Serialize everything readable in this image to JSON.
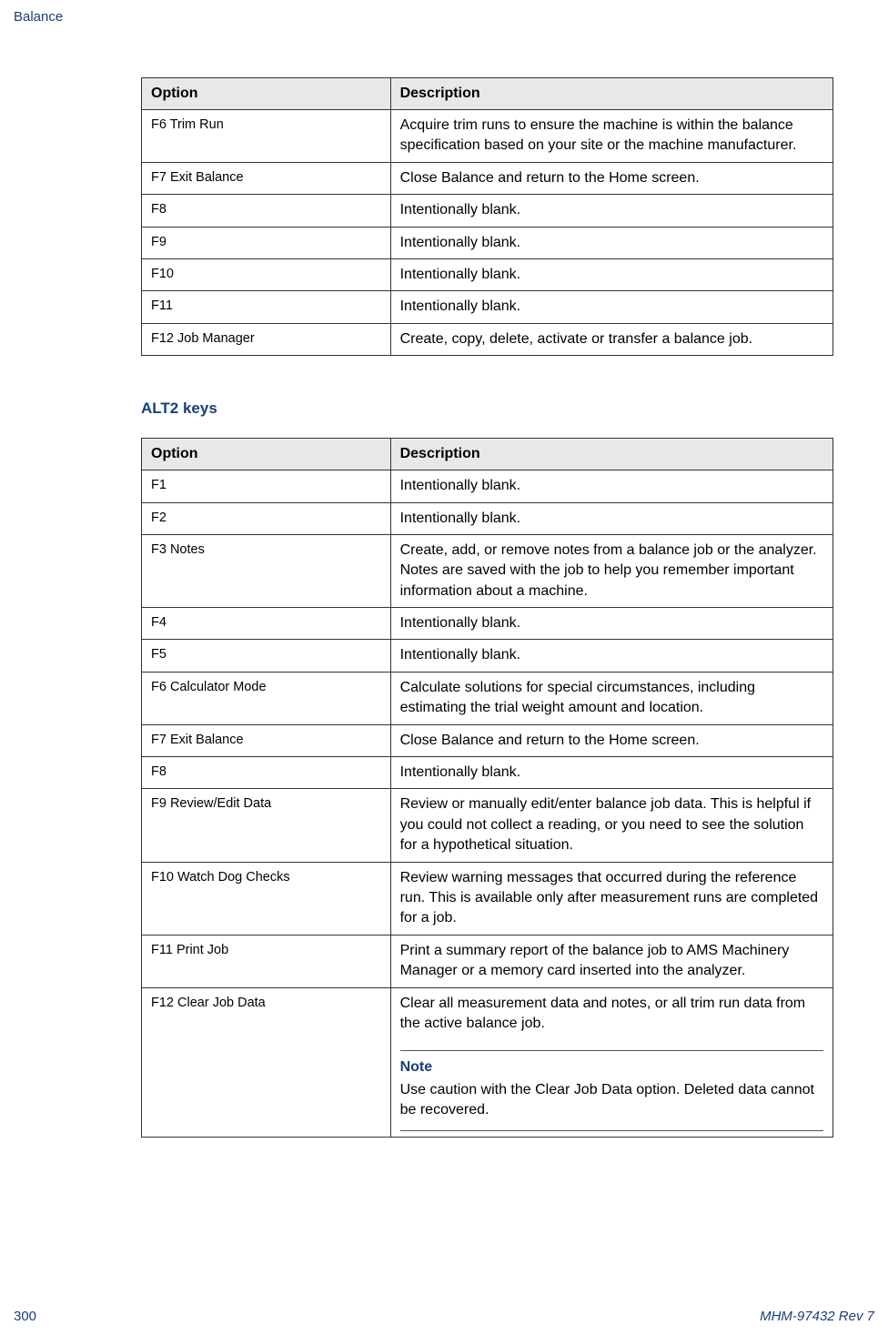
{
  "header": {
    "title": "Balance"
  },
  "tables": {
    "t1": {
      "header_option": "Option",
      "header_desc": "Description",
      "rows": [
        {
          "option": "F6 Trim Run",
          "desc": "Acquire trim runs to ensure the machine is within the balance specification based on your site or the machine manufacturer."
        },
        {
          "option": "F7 Exit Balance",
          "desc": "Close Balance and return to the Home screen."
        },
        {
          "option": "F8",
          "desc": "Intentionally blank."
        },
        {
          "option": "F9",
          "desc": "Intentionally blank."
        },
        {
          "option": "F10",
          "desc": "Intentionally blank."
        },
        {
          "option": "F11",
          "desc": "Intentionally blank."
        },
        {
          "option": "F12 Job Manager",
          "desc": "Create, copy, delete, activate or transfer a balance job."
        }
      ]
    },
    "section_heading": "ALT2 keys",
    "t2": {
      "header_option": "Option",
      "header_desc": "Description",
      "rows": [
        {
          "option": "F1",
          "desc": "Intentionally blank."
        },
        {
          "option": "F2",
          "desc": "Intentionally blank."
        },
        {
          "option": "F3 Notes",
          "desc": "Create, add, or remove notes from a balance job or the analyzer. Notes are saved with the job to help you remember important information about a machine."
        },
        {
          "option": "F4",
          "desc": "Intentionally blank."
        },
        {
          "option": "F5",
          "desc": "Intentionally blank."
        },
        {
          "option": "F6 Calculator Mode",
          "desc": "Calculate solutions for special circumstances, including estimating the trial weight amount and location."
        },
        {
          "option": "F7 Exit Balance",
          "desc": "Close Balance and return to the Home screen."
        },
        {
          "option": "F8",
          "desc": "Intentionally blank."
        },
        {
          "option": "F9 Review/Edit Data",
          "desc": "Review or manually edit/enter balance job data. This is helpful if you could not collect a reading, or you need to see the solution for a hypothetical situation."
        },
        {
          "option": "F10 Watch Dog Checks",
          "desc": "Review warning messages that occurred during the reference run. This is available only after measurement runs are completed for a job."
        },
        {
          "option": "F11 Print Job",
          "desc": "Print a summary report of the balance job to AMS Machinery Manager or a memory card inserted into the analyzer."
        },
        {
          "option": "F12 Clear Job Data",
          "desc": "Clear all measurement data and notes, or all trim run data from the active balance job.",
          "note_label": "Note",
          "note_text": "Use caution with the Clear Job Data option. Deleted data cannot be recovered."
        }
      ]
    }
  },
  "footer": {
    "page": "300",
    "doc": "MHM-97432 Rev 7"
  }
}
